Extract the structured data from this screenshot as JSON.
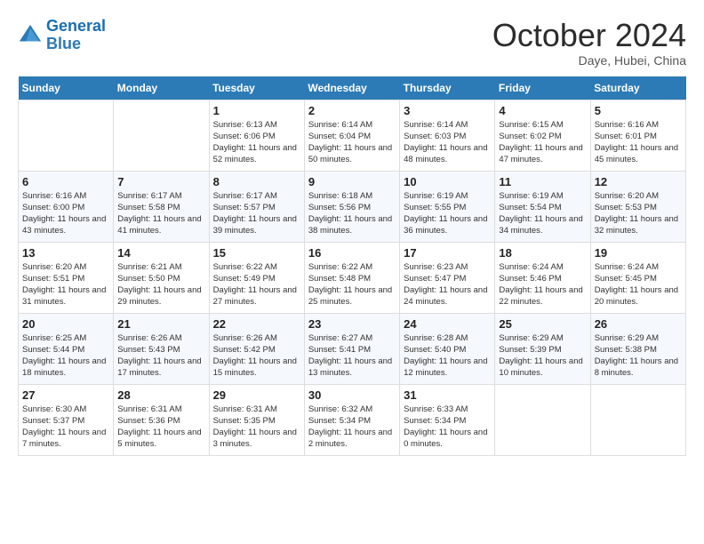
{
  "header": {
    "logo_line1": "General",
    "logo_line2": "Blue",
    "month_year": "October 2024",
    "location": "Daye, Hubei, China"
  },
  "calendar": {
    "weekdays": [
      "Sunday",
      "Monday",
      "Tuesday",
      "Wednesday",
      "Thursday",
      "Friday",
      "Saturday"
    ],
    "weeks": [
      [
        {
          "day": "",
          "info": ""
        },
        {
          "day": "",
          "info": ""
        },
        {
          "day": "1",
          "info": "Sunrise: 6:13 AM\nSunset: 6:06 PM\nDaylight: 11 hours and 52 minutes."
        },
        {
          "day": "2",
          "info": "Sunrise: 6:14 AM\nSunset: 6:04 PM\nDaylight: 11 hours and 50 minutes."
        },
        {
          "day": "3",
          "info": "Sunrise: 6:14 AM\nSunset: 6:03 PM\nDaylight: 11 hours and 48 minutes."
        },
        {
          "day": "4",
          "info": "Sunrise: 6:15 AM\nSunset: 6:02 PM\nDaylight: 11 hours and 47 minutes."
        },
        {
          "day": "5",
          "info": "Sunrise: 6:16 AM\nSunset: 6:01 PM\nDaylight: 11 hours and 45 minutes."
        }
      ],
      [
        {
          "day": "6",
          "info": "Sunrise: 6:16 AM\nSunset: 6:00 PM\nDaylight: 11 hours and 43 minutes."
        },
        {
          "day": "7",
          "info": "Sunrise: 6:17 AM\nSunset: 5:58 PM\nDaylight: 11 hours and 41 minutes."
        },
        {
          "day": "8",
          "info": "Sunrise: 6:17 AM\nSunset: 5:57 PM\nDaylight: 11 hours and 39 minutes."
        },
        {
          "day": "9",
          "info": "Sunrise: 6:18 AM\nSunset: 5:56 PM\nDaylight: 11 hours and 38 minutes."
        },
        {
          "day": "10",
          "info": "Sunrise: 6:19 AM\nSunset: 5:55 PM\nDaylight: 11 hours and 36 minutes."
        },
        {
          "day": "11",
          "info": "Sunrise: 6:19 AM\nSunset: 5:54 PM\nDaylight: 11 hours and 34 minutes."
        },
        {
          "day": "12",
          "info": "Sunrise: 6:20 AM\nSunset: 5:53 PM\nDaylight: 11 hours and 32 minutes."
        }
      ],
      [
        {
          "day": "13",
          "info": "Sunrise: 6:20 AM\nSunset: 5:51 PM\nDaylight: 11 hours and 31 minutes."
        },
        {
          "day": "14",
          "info": "Sunrise: 6:21 AM\nSunset: 5:50 PM\nDaylight: 11 hours and 29 minutes."
        },
        {
          "day": "15",
          "info": "Sunrise: 6:22 AM\nSunset: 5:49 PM\nDaylight: 11 hours and 27 minutes."
        },
        {
          "day": "16",
          "info": "Sunrise: 6:22 AM\nSunset: 5:48 PM\nDaylight: 11 hours and 25 minutes."
        },
        {
          "day": "17",
          "info": "Sunrise: 6:23 AM\nSunset: 5:47 PM\nDaylight: 11 hours and 24 minutes."
        },
        {
          "day": "18",
          "info": "Sunrise: 6:24 AM\nSunset: 5:46 PM\nDaylight: 11 hours and 22 minutes."
        },
        {
          "day": "19",
          "info": "Sunrise: 6:24 AM\nSunset: 5:45 PM\nDaylight: 11 hours and 20 minutes."
        }
      ],
      [
        {
          "day": "20",
          "info": "Sunrise: 6:25 AM\nSunset: 5:44 PM\nDaylight: 11 hours and 18 minutes."
        },
        {
          "day": "21",
          "info": "Sunrise: 6:26 AM\nSunset: 5:43 PM\nDaylight: 11 hours and 17 minutes."
        },
        {
          "day": "22",
          "info": "Sunrise: 6:26 AM\nSunset: 5:42 PM\nDaylight: 11 hours and 15 minutes."
        },
        {
          "day": "23",
          "info": "Sunrise: 6:27 AM\nSunset: 5:41 PM\nDaylight: 11 hours and 13 minutes."
        },
        {
          "day": "24",
          "info": "Sunrise: 6:28 AM\nSunset: 5:40 PM\nDaylight: 11 hours and 12 minutes."
        },
        {
          "day": "25",
          "info": "Sunrise: 6:29 AM\nSunset: 5:39 PM\nDaylight: 11 hours and 10 minutes."
        },
        {
          "day": "26",
          "info": "Sunrise: 6:29 AM\nSunset: 5:38 PM\nDaylight: 11 hours and 8 minutes."
        }
      ],
      [
        {
          "day": "27",
          "info": "Sunrise: 6:30 AM\nSunset: 5:37 PM\nDaylight: 11 hours and 7 minutes."
        },
        {
          "day": "28",
          "info": "Sunrise: 6:31 AM\nSunset: 5:36 PM\nDaylight: 11 hours and 5 minutes."
        },
        {
          "day": "29",
          "info": "Sunrise: 6:31 AM\nSunset: 5:35 PM\nDaylight: 11 hours and 3 minutes."
        },
        {
          "day": "30",
          "info": "Sunrise: 6:32 AM\nSunset: 5:34 PM\nDaylight: 11 hours and 2 minutes."
        },
        {
          "day": "31",
          "info": "Sunrise: 6:33 AM\nSunset: 5:34 PM\nDaylight: 11 hours and 0 minutes."
        },
        {
          "day": "",
          "info": ""
        },
        {
          "day": "",
          "info": ""
        }
      ]
    ]
  }
}
